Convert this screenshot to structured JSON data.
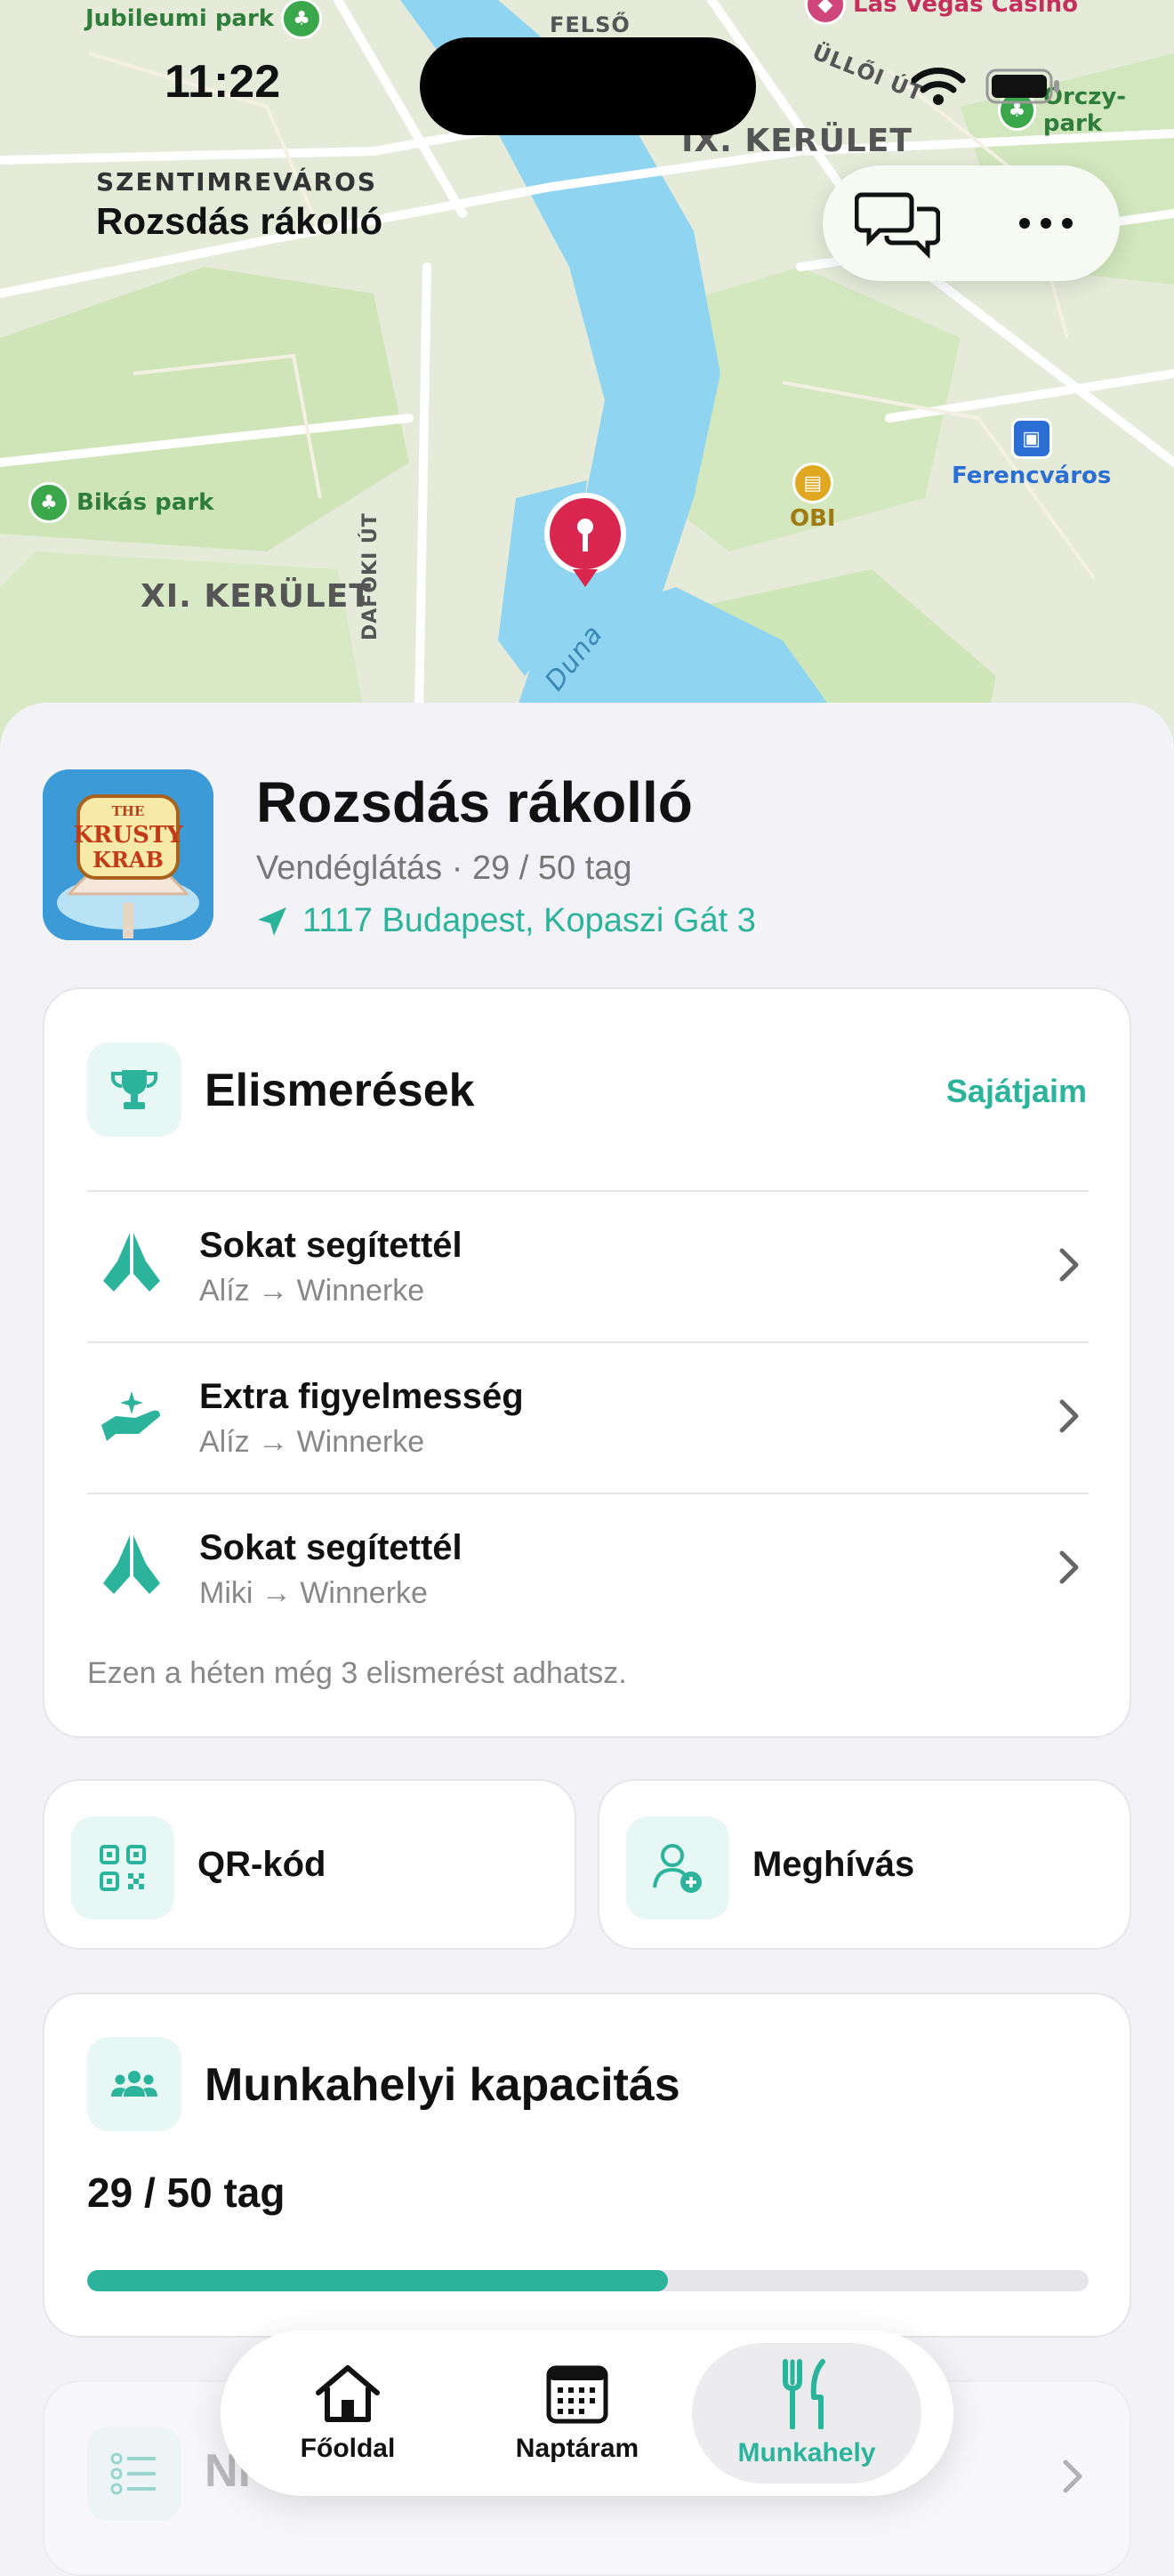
{
  "status_bar": {
    "time": "11:22"
  },
  "map": {
    "district": "SZENTIMREVÁROS",
    "place_title": "Rozsdás rákolló",
    "labels": {
      "jubileumi": "Jubileumi park",
      "las_vegas": "Las Vegas Casino",
      "felso": "FELSŐ",
      "ulloi": "ÜLLŐI ÚT",
      "orczy": "Orczy-park",
      "ix": "IX. KERÜLET",
      "bikas": "Bikás park",
      "xi": "XI. KERÜLET",
      "ferencvaros": "Ferencváros",
      "obi": "OBI",
      "soroksari": "DAFOKI ÚT",
      "duna": "Duna"
    }
  },
  "workplace": {
    "name": "Rozsdás rákolló",
    "category": "Vendéglátás",
    "members": "29 / 50 tag",
    "address": "1117 Budapest, Kopaszi Gát 3",
    "logo_text": [
      "THE",
      "KRUSTY",
      "KRAB"
    ]
  },
  "recognitions": {
    "title": "Elismerések",
    "link": "Sajátjaim",
    "items": [
      {
        "title": "Sokat segítettél",
        "subtitle": "Alíz → Winnerke",
        "icon": "praying-hands-icon"
      },
      {
        "title": "Extra figyelmesség",
        "subtitle": "Alíz → Winnerke",
        "icon": "hand-sparkle-icon"
      },
      {
        "title": "Sokat segítettél",
        "subtitle": "Miki → Winnerke",
        "icon": "praying-hands-icon"
      }
    ],
    "footer": "Ezen a héten még 3 elismerést adhatsz."
  },
  "actions": {
    "qr": "QR-kód",
    "invite": "Meghívás"
  },
  "capacity": {
    "title": "Munkahelyi kapacitás",
    "value": "29 / 50 tag",
    "fraction": 0.58
  },
  "next_card": {
    "title_partial": "Ni"
  },
  "tabbar": {
    "home": "Főoldal",
    "calendar": "Naptáram",
    "workplace": "Munkahely"
  },
  "colors": {
    "accent": "#2bb39b",
    "accent_light": "#e7f7f4",
    "map_water": "#8dd3f0",
    "pin": "#d9264f"
  }
}
